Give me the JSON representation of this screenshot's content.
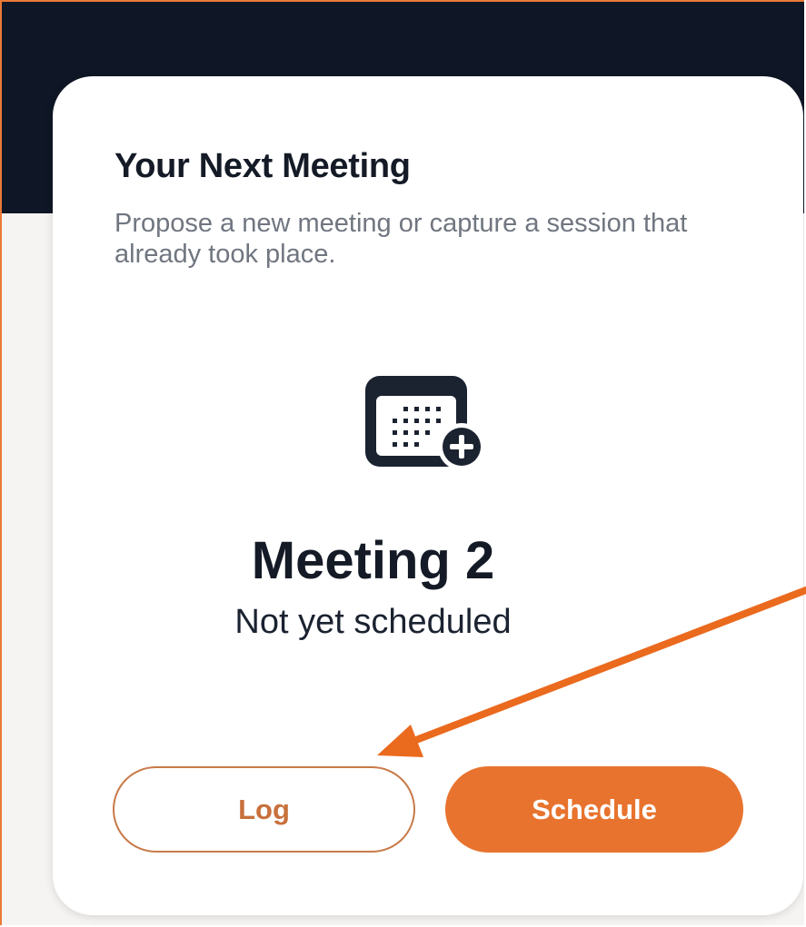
{
  "card": {
    "title": "Your Next Meeting",
    "subtitle": "Propose a new meeting or capture a session that already took place.",
    "icon": "calendar-add-icon",
    "meeting_name": "Meeting 2",
    "meeting_status": "Not yet scheduled"
  },
  "actions": {
    "log_label": "Log",
    "schedule_label": "Schedule"
  },
  "colors": {
    "accent": "#e8732e",
    "header_band": "#0f1726",
    "annotation": "#ea6a1e"
  }
}
